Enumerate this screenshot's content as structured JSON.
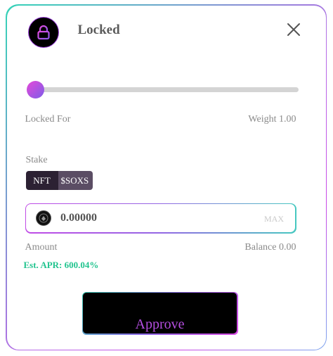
{
  "modal": {
    "title": "Locked",
    "header_icon": "lock-icon",
    "close_icon": "close-icon"
  },
  "slider": {
    "value_fraction": 0.0
  },
  "locked_row": {
    "label": "Locked For",
    "weight": "Weight 1.00"
  },
  "stake": {
    "label": "Stake",
    "options": [
      "NFT",
      "$SOXS"
    ],
    "selected": "NFT"
  },
  "amount_input": {
    "value": "0.00000",
    "max_label": "MAX",
    "token_icon": "token-logo-icon"
  },
  "amount_row": {
    "label": "Amount",
    "balance": "Balance 0.00"
  },
  "apr": "Est. APR: 600.04%",
  "approve_button": {
    "label": "Approve"
  },
  "colors": {
    "accent_purple": "#b44ee0",
    "accent_teal": "#34d3b7",
    "apr_green": "#22c48f"
  }
}
